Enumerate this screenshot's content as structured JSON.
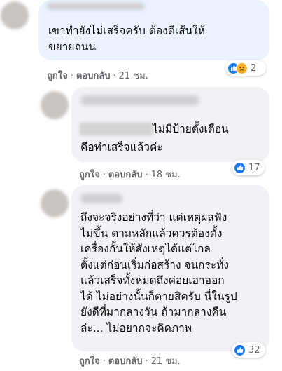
{
  "colors": {
    "bubble": "#f0f2f5",
    "highlight_bubble": "#eaf3ff",
    "like_blue": "#1877f2",
    "sad_yellow": "#f7b125",
    "meta_gray": "#65676b"
  },
  "comments": [
    {
      "text": "เขาทำยังไม่เสร็จครับ ต้องตีเส้นให้\nขยายถนน",
      "like_label": "ถูกใจ",
      "reply_label": "ตอบกลับ",
      "time": "21 ชม.",
      "reactions": [
        "like-icon",
        "sad-icon"
      ],
      "reaction_count": "2"
    },
    {
      "text_line1": "ไม่มีป้ายตั้งเตือน",
      "text_line2": "คือทำเสร็จแล้วค่ะ",
      "like_label": "ถูกใจ",
      "reply_label": "ตอบกลับ",
      "time": "18 ชม.",
      "reactions": [
        "like-icon"
      ],
      "reaction_count": "17"
    },
    {
      "text": "ถึงจะจริงอย่างที่ว่า แต่เหตุผลฟัง\nไม่ขึ้น ตามหลักแล้วควรต้องตั้ง\nเครื่องกั้นให้สังเหตุได้แต่ไกล\nตั้งแต่ก่อนเริ่มก่อสร้าง จนกระทั่ง\nแล้วเสร็จทั้งหมดถึงค่อยเอาออก\nได้ ไม่อย่างนั้นก็ตายสิครับ นี่ในรูป\nยังดีที่มากลางวัน ถ้ามากลางคืน\nล่ะ... ไม่อยากจะคิดภาพ",
      "like_label": "ถูกใจ",
      "reply_label": "ตอบกลับ",
      "time": "21 ชม.",
      "reactions": [
        "like-icon"
      ],
      "reaction_count": "32"
    }
  ]
}
